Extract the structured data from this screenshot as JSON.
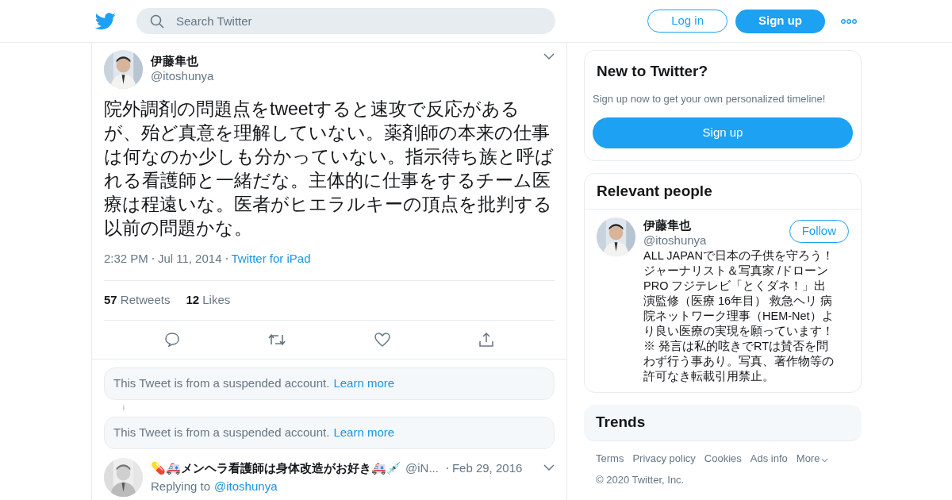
{
  "header": {
    "search": {
      "placeholder": "Search Twitter"
    },
    "buttons": [
      {
        "kind": "outline",
        "label": "Log in"
      },
      {
        "kind": "solid",
        "label": "Sign up"
      }
    ]
  },
  "tweet": {
    "name": "伊藤隼也",
    "handle": "@itoshunya",
    "text": "院外調剤の問題点をtweetすると速攻で反応があるが、殆ど真意を理解していない。薬剤師の本来の仕事は何なのか少しも分かっていない。指示待ち族と呼ばれる看護師と一緒だな。主体的に仕事をするチーム医療は程遠いな。医者がヒエラルキーの頂点を批判する以前の問題かな。",
    "time": "2:32 PM",
    "date": "Jul 11, 2014",
    "source": "Twitter for iPad",
    "stats": [
      {
        "count": "57",
        "label": "Retweets"
      },
      {
        "count": "12",
        "label": "Likes"
      }
    ]
  },
  "suspended": [
    {
      "text": "This Tweet is from a suspended account.",
      "link": "Learn more"
    },
    {
      "text": "This Tweet is from a suspended account.",
      "link": "Learn more"
    }
  ],
  "reply": {
    "name": "💊🚑メンヘラ看護師は身体改造がお好き🚑💉",
    "handle": "@iN...",
    "date": "Feb 29, 2016",
    "replying_label": "Replying to",
    "replying_to": "@itoshunya"
  },
  "signup_card": {
    "title": "New to Twitter?",
    "subtitle": "Sign up now to get your own personalized timeline!",
    "button": "Sign up"
  },
  "relevant": {
    "title": "Relevant people",
    "person": {
      "name": "伊藤隼也",
      "handle": "@itoshunya",
      "follow": "Follow",
      "bio": "ALL JAPANで日本の子供を守ろう！ジャーナリスト＆写真家 /ドローンPRO フジテレビ「とくダネ！」出演監修（医療 16年目） 救急ヘリ 病院ネットワーク理事（HEM-Net）より良い医療の実現を願っています！※ 発言は私的呟きでRTは賛否を問わず行う事あり。写真、著作物等の許可なき転載引用禁止。"
    }
  },
  "trends": {
    "title": "Trends"
  },
  "footer": {
    "links": [
      "Terms",
      "Privacy policy",
      "Cookies",
      "Ads info",
      "More"
    ],
    "copyright": "© 2020 Twitter, Inc."
  }
}
